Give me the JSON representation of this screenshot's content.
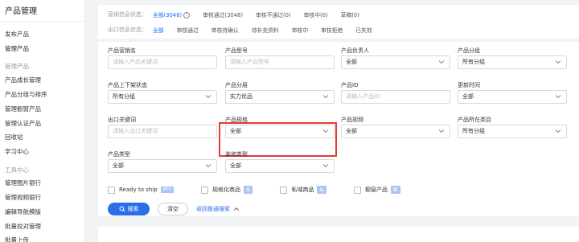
{
  "sidebar": {
    "title": "产品管理",
    "items": [
      {
        "label": "发布产品",
        "section": false
      },
      {
        "label": "管理产品",
        "section": false
      },
      {
        "label": "管理产品",
        "section": true
      },
      {
        "label": "产品成长管理",
        "section": false
      },
      {
        "label": "产品分组与排序",
        "section": false
      },
      {
        "label": "管理橱窗产品",
        "section": false
      },
      {
        "label": "管理认证产品",
        "section": false
      },
      {
        "label": "回收站",
        "section": false
      },
      {
        "label": "学习中心",
        "section": false
      },
      {
        "label": "工具中心",
        "section": true
      },
      {
        "label": "管理图片银行",
        "section": false
      },
      {
        "label": "管理视频银行",
        "section": false
      },
      {
        "label": "编辑导航模版",
        "section": false
      },
      {
        "label": "批量校对管理",
        "section": false
      },
      {
        "label": "批量上传",
        "section": false
      }
    ]
  },
  "filters": {
    "marketing_status": {
      "label": "营销信息状态：",
      "options": [
        "全部(3048)",
        "审核通过(3048)",
        "审核不通过(0)",
        "审核中(0)",
        "草稿(0)"
      ]
    },
    "export_status": {
      "label": "出口信息状态：",
      "options": [
        "全部",
        "审核通过",
        "审核待确认",
        "待补充资料",
        "审核中",
        "审核拒绝",
        "已失效"
      ]
    }
  },
  "fields": [
    {
      "label": "产品营销名",
      "value": "请输入产品关键词",
      "placeholder": true,
      "dropdown": false
    },
    {
      "label": "产品型号",
      "value": "请输入产品型号",
      "placeholder": true,
      "dropdown": false
    },
    {
      "label": "产品负责人",
      "value": "全部",
      "placeholder": false,
      "dropdown": true
    },
    {
      "label": "产品分组",
      "value": "所有分组",
      "placeholder": false,
      "dropdown": true
    },
    {
      "label": "产品上下架状态",
      "value": "所有分组",
      "placeholder": false,
      "dropdown": true
    },
    {
      "label": "产品分层",
      "value": "实力优品",
      "placeholder": false,
      "dropdown": true
    },
    {
      "label": "产品ID",
      "value": "请输入产品ID",
      "placeholder": true,
      "dropdown": false
    },
    {
      "label": "更新时间",
      "value": "全部",
      "placeholder": false,
      "dropdown": true
    },
    {
      "label": "出口关键词",
      "value": "请输入出口关键词",
      "placeholder": true,
      "dropdown": false
    },
    {
      "label": "产品规格",
      "value": "全部",
      "placeholder": false,
      "dropdown": true
    },
    {
      "label": "产品视频",
      "value": "全部",
      "placeholder": false,
      "dropdown": true
    },
    {
      "label": "产品所在类目",
      "value": "所有分组",
      "placeholder": false,
      "dropdown": true
    },
    {
      "label": "产品类型",
      "value": "全部",
      "placeholder": false,
      "dropdown": true
    },
    {
      "label": "装修类型",
      "value": "全部",
      "placeholder": false,
      "dropdown": true
    }
  ],
  "checkboxes": [
    {
      "label": "Ready to ship",
      "tag": "RTS"
    },
    {
      "label": "规格化商品",
      "tag": "规"
    },
    {
      "label": "私域商品",
      "tag": "私"
    },
    {
      "label": "橱窗产品",
      "tag": "橱"
    }
  ],
  "actions": {
    "search": "搜索",
    "reset": "清空",
    "back": "返回普通搜索"
  },
  "colors": {
    "accent": "#2a6ee8",
    "highlight": "#e53935"
  }
}
